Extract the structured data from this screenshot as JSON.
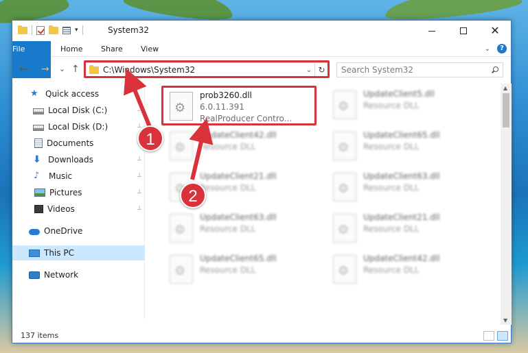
{
  "window": {
    "title": "System32",
    "controls": {
      "minimize": "—",
      "maximize": "□",
      "close": "✕"
    }
  },
  "ribbon": {
    "tabs": [
      "File",
      "Home",
      "Share",
      "View"
    ],
    "help": "?"
  },
  "navigation": {
    "back": "←",
    "forward": "→",
    "recent": "⌄",
    "up": "↑",
    "address": "C:\\Windows\\System32",
    "address_dropdown": "⌄",
    "refresh": "↻",
    "search_placeholder": "Search System32"
  },
  "sidebar": {
    "items": [
      {
        "label": "Quick access",
        "icon": "star-icon",
        "pinned": false
      },
      {
        "label": "Local Disk (C:)",
        "icon": "disk-icon",
        "pinned": true
      },
      {
        "label": "Local Disk (D:)",
        "icon": "disk-icon",
        "pinned": true
      },
      {
        "label": "Documents",
        "icon": "documents-icon",
        "pinned": true
      },
      {
        "label": "Downloads",
        "icon": "download-icon",
        "pinned": true
      },
      {
        "label": "Music",
        "icon": "music-icon",
        "pinned": true
      },
      {
        "label": "Pictures",
        "icon": "pictures-icon",
        "pinned": true
      },
      {
        "label": "Videos",
        "icon": "videos-icon",
        "pinned": true
      },
      {
        "label": "OneDrive",
        "icon": "cloud-icon",
        "pinned": false
      },
      {
        "label": "This PC",
        "icon": "computer-icon",
        "pinned": false,
        "selected": true
      },
      {
        "label": "Network",
        "icon": "network-icon",
        "pinned": false
      }
    ],
    "pin_glyph": "📌"
  },
  "files": {
    "focused": {
      "name": "prob3260.dll",
      "version": "6.0.11.391",
      "description": "RealProducer Contro..."
    },
    "left_column": [
      {
        "name": "UpdateClient42.dll",
        "type": "Resource DLL"
      },
      {
        "name": "UpdateClient21.dll",
        "type": "Resource DLL"
      },
      {
        "name": "UpdateClient63.dll",
        "type": "Resource DLL"
      },
      {
        "name": "UpdateClient65.dll",
        "type": "Resource DLL"
      }
    ],
    "right_column": [
      {
        "name": "UpdateClient5.dll",
        "type": "Resource DLL"
      },
      {
        "name": "UpdateClient65.dll",
        "type": "Resource DLL"
      },
      {
        "name": "UpdateClient63.dll",
        "type": "Resource DLL"
      },
      {
        "name": "UpdateClient21.dll",
        "type": "Resource DLL"
      },
      {
        "name": "UpdateClient42.dll",
        "type": "Resource DLL"
      }
    ]
  },
  "status": {
    "item_count": "137 items"
  },
  "annotations": {
    "step1": "1",
    "step2": "2",
    "color": "#d9323b"
  }
}
